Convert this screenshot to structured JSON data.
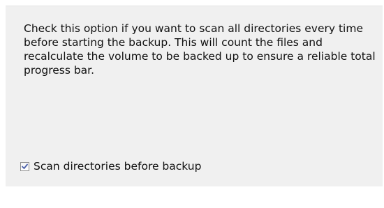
{
  "description": "Check this option if you want to scan all directories every time before starting the backup. This will count the files and recalculate the volume to be backed up to ensure a reliable total progress bar.",
  "option": {
    "label": "Scan directories before backup",
    "checked": true,
    "check_color": "#4a5fa8"
  },
  "colors": {
    "panel_background": "#f0f0f0",
    "page_background": "#ffffff",
    "text": "#111111"
  }
}
